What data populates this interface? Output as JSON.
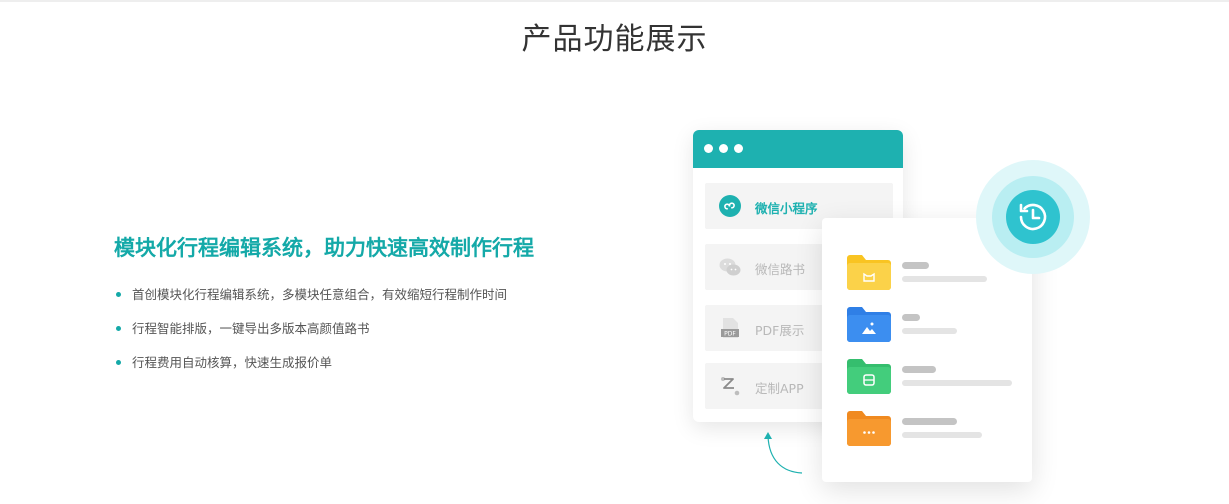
{
  "section": {
    "title": "产品功能展示"
  },
  "feature": {
    "heading": "模块化行程编辑系统，助力快速高效制作行程",
    "bullets": [
      "首创模块化行程编辑系统，多模块任意组合，有效缩短行程制作时间",
      "行程智能排版，一键导出多版本高颜值路书",
      "行程费用自动核算，快速生成报价单"
    ]
  },
  "illustration": {
    "menu": [
      {
        "label": "微信小程序",
        "icon": "mini-program-icon",
        "active": true
      },
      {
        "label": "微信路书",
        "icon": "wechat-icon",
        "active": false
      },
      {
        "label": "PDF展示",
        "icon": "pdf-icon",
        "active": false
      },
      {
        "label": "定制APP",
        "icon": "route-icon",
        "active": false
      }
    ],
    "pdf_icon_text": "PDF",
    "folders": [
      {
        "icon": "cat-icon",
        "color": "#f9c422"
      },
      {
        "icon": "image-icon",
        "color": "#3c8ef0"
      },
      {
        "icon": "bus-icon",
        "color": "#3fc978"
      },
      {
        "icon": "more-icon",
        "color": "#f7922a"
      }
    ],
    "badge_icon": "history-icon"
  },
  "colors": {
    "accent": "#14a9a8",
    "window_bar": "#1eb1b0",
    "badge": "#2fc3cf"
  }
}
